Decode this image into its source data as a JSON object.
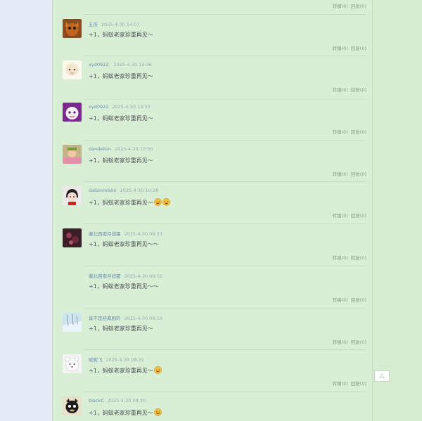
{
  "colors": {
    "page_bg": "#e3ecf6",
    "panel_bg": "#d9efd5",
    "link": "#6b8db3"
  },
  "action_labels": {
    "forward": "转播(0)",
    "reply": "回复(0)"
  },
  "back_to_top": {
    "icon": "arrow-up-icon",
    "glyph": "△"
  },
  "comments": [
    {
      "user": "",
      "time": "",
      "text": "",
      "avatar": "partial"
    },
    {
      "user": "五侄",
      "time": "2025-4-30 14:07",
      "text": "+1，蚂蚁老家珍重再见～",
      "avatar": "cat-photo"
    },
    {
      "user": "xyd0922.",
      "time": "2025-4-30 13:36",
      "text": "+1，蚂蚁老家珍重再见～",
      "avatar": "sheep-cartoon"
    },
    {
      "user": "xyd0922",
      "time": "2025-4-30 13:33",
      "text": "+1，蚂蚁老家珍重再见～",
      "avatar": "purple-cartoon"
    },
    {
      "user": "dandelion",
      "time": "2025-4-30 12:50",
      "text": "+1，蚂蚁老家珍重再见～",
      "avatar": "child-photo"
    },
    {
      "user": "daibinmilolo",
      "time": "2025-4-30 10:26",
      "text": "+1，蚂蚁老家珍重再见～",
      "avatar": "girl-cartoon",
      "emoji_count": 2
    },
    {
      "user": "塞北西南月如霜",
      "time": "2025-4-30 09:53",
      "text": "+1，蚂蚁老家珍重再见～～",
      "avatar": "flower-photo"
    },
    {
      "user": "塞北西南月如霜",
      "time": "2025-4-30 09:52",
      "text": "+1，蚂蚁老家珍重再见～～",
      "avatar": "none"
    },
    {
      "user": "真不是经典剧的",
      "time": "2025-4-30 09:13",
      "text": "+1，蚂蚁老家珍重再见～",
      "avatar": "winter-photo"
    },
    {
      "user": "昵昵飞",
      "time": "2025-4-30 08:31",
      "text": "+1，蚂蚁老家珍重再见～",
      "avatar": "white-bear",
      "emoji_count": 1
    },
    {
      "user": "blackC",
      "time": "2025-4-30 08:30",
      "text": "+1，蚂蚁老家珍重再见～",
      "avatar": "black-cat",
      "emoji_count": 1
    }
  ]
}
